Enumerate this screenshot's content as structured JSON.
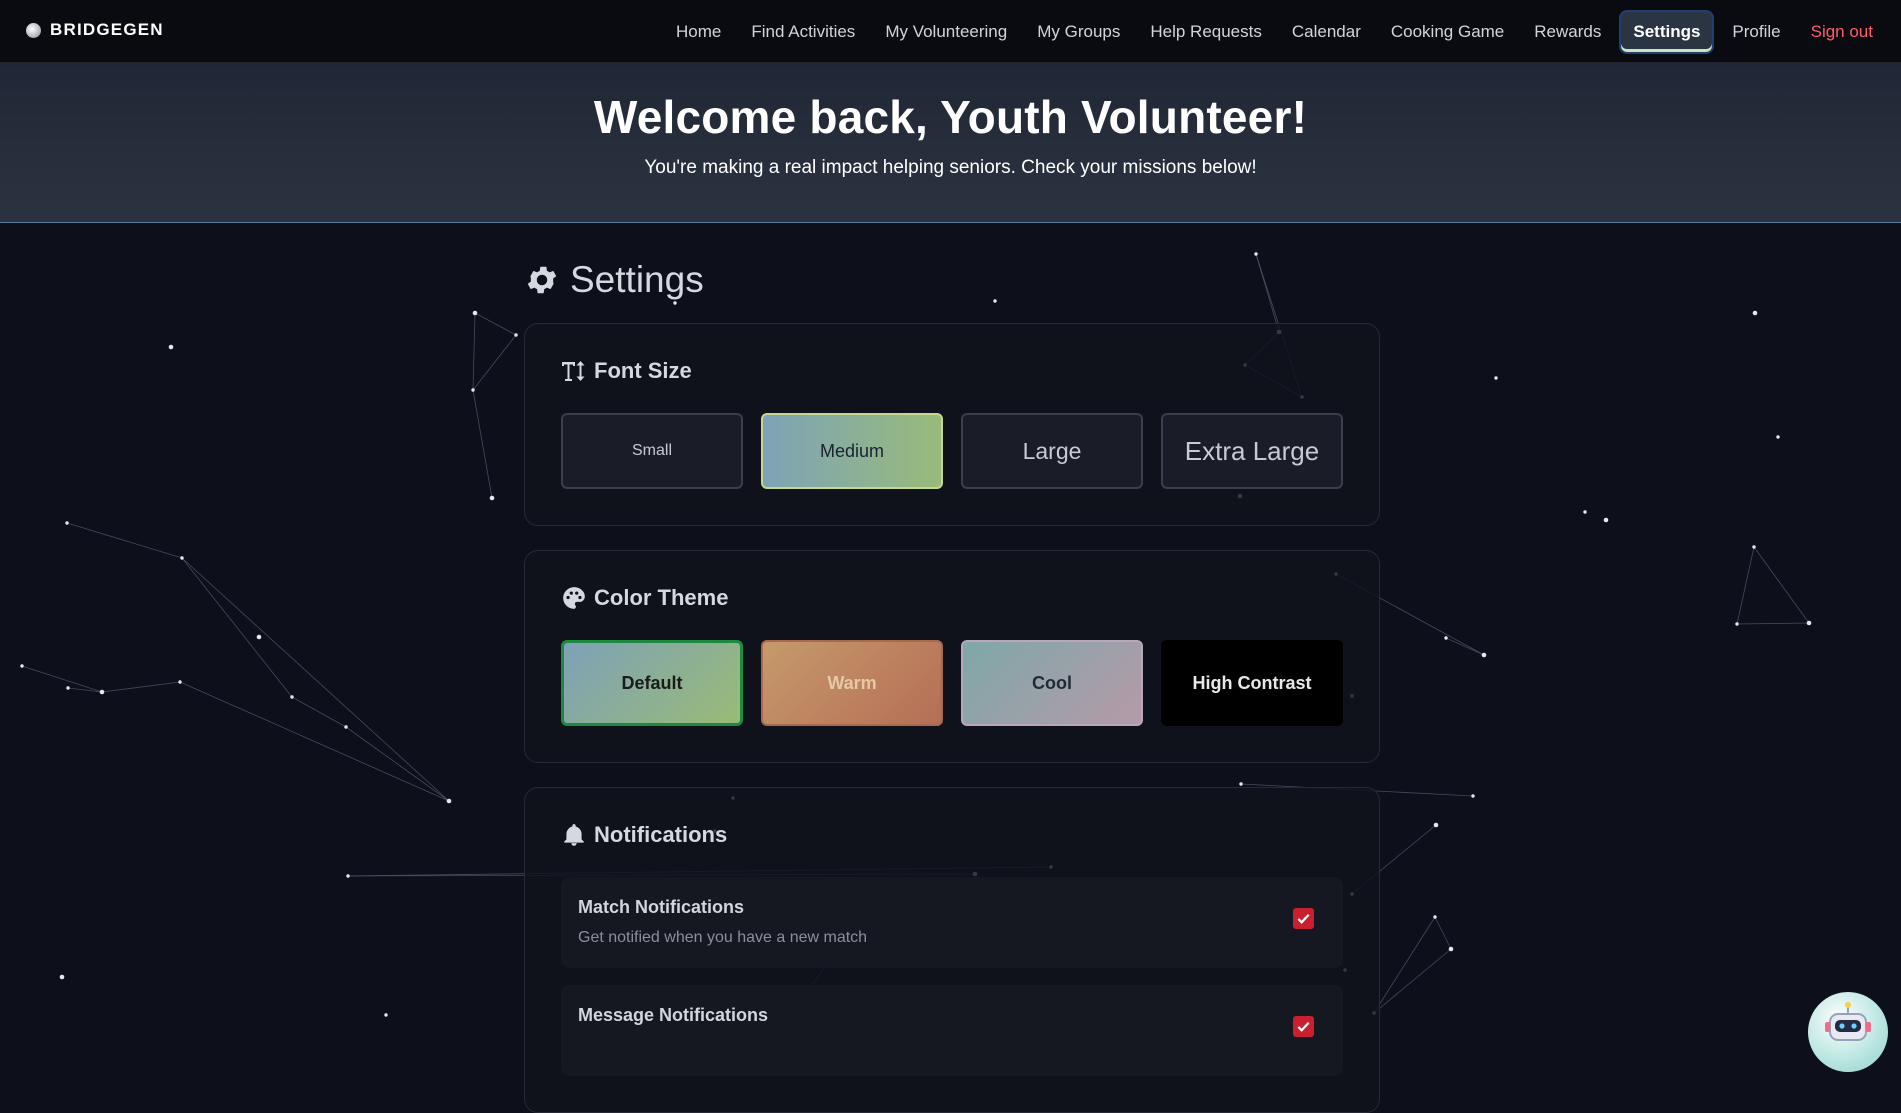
{
  "brand": {
    "name": "BRIDGEGEN"
  },
  "nav": {
    "items": [
      {
        "label": "Home"
      },
      {
        "label": "Find Activities"
      },
      {
        "label": "My Volunteering"
      },
      {
        "label": "My Groups"
      },
      {
        "label": "Help Requests"
      },
      {
        "label": "Calendar"
      },
      {
        "label": "Cooking Game"
      },
      {
        "label": "Rewards"
      },
      {
        "label": "Settings",
        "active": true
      },
      {
        "label": "Profile"
      },
      {
        "label": "Sign out"
      }
    ]
  },
  "hero": {
    "title": "Welcome back, Youth Volunteer!",
    "subtitle": "You're making a real impact helping seniors. Check your missions below!"
  },
  "settings": {
    "title": "Settings",
    "font_size": {
      "title": "Font Size",
      "options": [
        {
          "label": "Small",
          "selected": false
        },
        {
          "label": "Medium",
          "selected": true
        },
        {
          "label": "Large",
          "selected": false
        },
        {
          "label": "Extra Large",
          "selected": false
        }
      ]
    },
    "color_theme": {
      "title": "Color Theme",
      "options": [
        {
          "label": "Default",
          "selected": true
        },
        {
          "label": "Warm",
          "selected": false
        },
        {
          "label": "Cool",
          "selected": false
        },
        {
          "label": "High Contrast",
          "selected": false
        }
      ]
    },
    "notifications": {
      "title": "Notifications",
      "items": [
        {
          "name": "Match Notifications",
          "description": "Get notified when you have a new match",
          "checked": true
        },
        {
          "name": "Message Notifications",
          "description": "",
          "checked": true
        }
      ]
    }
  },
  "colors": {
    "background": "#0d0f1a",
    "accent_active": "#2b3443",
    "signout": "#ff5d6a",
    "checkbox": "#c8202f",
    "selected_border": "#1c8a3f"
  },
  "icons": {
    "settings": "gear-icon",
    "font_size": "text-height-icon",
    "color_theme": "palette-icon",
    "notifications": "bell-icon",
    "assistant": "robot-icon"
  }
}
